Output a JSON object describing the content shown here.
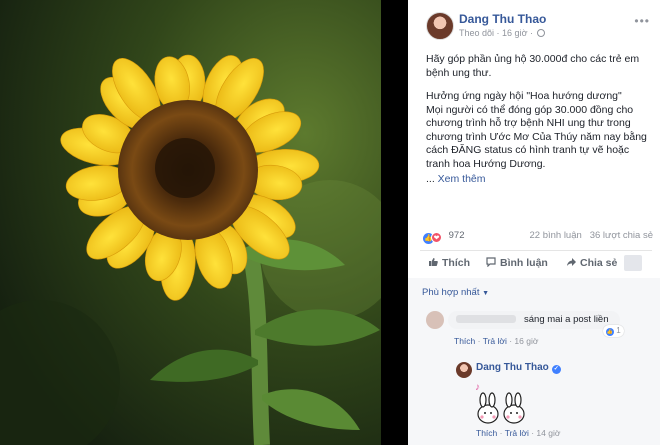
{
  "post": {
    "author": "Dang Thu Thao",
    "follow_label": "Theo dõi",
    "time": "16 giờ",
    "more_icon": "ellipsis-icon",
    "privacy_icon": "globe-icon",
    "body_p1": "Hãy góp phần ủng hộ 30.000đ cho các trẻ em bệnh ung thư.",
    "body_p2": "Hưởng ứng ngày hội \"Hoa hướng dương\"\nMọi người có thể đóng góp 30.000 đồng cho chương trình hỗ trợ bệnh NHI ung thư trong chương trình Ước Mơ Của Thúy năm nay bằng cách ĐĂNG status có hình tranh tự vẽ hoặc tranh hoa Hướng Dương.",
    "see_more_prefix": "... ",
    "see_more": "Xem thêm"
  },
  "stats": {
    "reactions_count": "972",
    "comments": "22 bình luận",
    "shares": "36 lượt chia sẻ"
  },
  "actions": {
    "like": "Thích",
    "comment": "Bình luận",
    "share": "Chia sẻ"
  },
  "comments": {
    "sort_label": "Phù hợp nhất",
    "c1": {
      "text": "sáng mai a post liền",
      "like_count": "1",
      "like": "Thích",
      "reply": "Trả lời",
      "time": "16 giờ"
    },
    "c2": {
      "author": "Dang Thu Thao",
      "note": "♪",
      "like": "Thích",
      "reply": "Trả lời",
      "time": "14 giờ"
    }
  },
  "colors": {
    "link": "#365899",
    "like_blue": "#4080ff",
    "love_red": "#f25268"
  }
}
